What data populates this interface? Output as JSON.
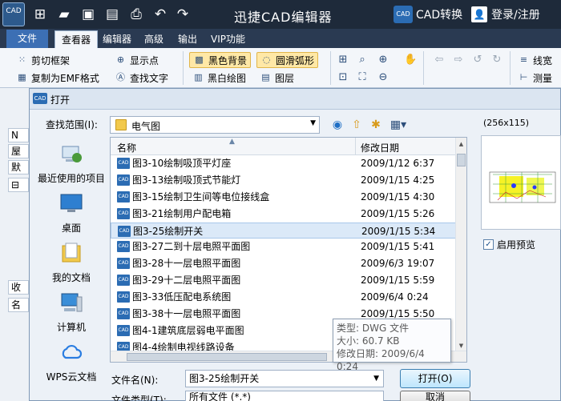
{
  "app": {
    "logo_text": "CAD",
    "title": "迅捷CAD编辑器",
    "convert_label": "CAD转换",
    "convert_icon_text": "CAD",
    "login_label": "登录/注册"
  },
  "ribbon": {
    "tabs": [
      "文件",
      "查看器",
      "编辑器",
      "高级",
      "输出",
      "VIP功能"
    ],
    "active_tab": "查看器",
    "buttons": {
      "clip_frame": "剪切框架",
      "copy_emf": "复制为EMF格式",
      "show_point": "显示点",
      "find_text": "查找文字",
      "black_bg": "黑色背景",
      "bw_draw": "黑白绘图",
      "smooth_arc": "圆滑弧形",
      "layers": "图层",
      "linewidth": "线宽",
      "measure": "测量"
    }
  },
  "background_left": {
    "cells": [
      "N",
      "屋",
      "默",
      "⊟",
      "收",
      "名"
    ]
  },
  "dialog": {
    "title": "打开",
    "icon_text": "CAD",
    "look_in_label": "查找范围(I):",
    "look_in_value": "电气图",
    "places": [
      {
        "label": "最近使用的项目",
        "icon": "recent-icon"
      },
      {
        "label": "桌面",
        "icon": "desktop-icon"
      },
      {
        "label": "我的文档",
        "icon": "documents-icon"
      },
      {
        "label": "计算机",
        "icon": "computer-icon"
      },
      {
        "label": "WPS云文档",
        "icon": "cloud-icon"
      }
    ],
    "columns": {
      "name": "名称",
      "date": "修改日期"
    },
    "file_icon_text": "CAD",
    "files": [
      {
        "name": "图3-10绘制吸顶平灯座",
        "date": "2009/1/12 6:37"
      },
      {
        "name": "图3-13绘制吸顶式节能灯",
        "date": "2009/1/15 4:25"
      },
      {
        "name": "图3-15绘制卫生间等电位接线盒",
        "date": "2009/1/15 4:30"
      },
      {
        "name": "图3-21绘制用户配电箱",
        "date": "2009/1/15 5:26"
      },
      {
        "name": "图3-25绘制开关",
        "date": "2009/1/15 5:34"
      },
      {
        "name": "图3-27二到十层电照平面图",
        "date": "2009/1/15 5:41"
      },
      {
        "name": "图3-28十一层电照平面图",
        "date": "2009/6/3 19:07"
      },
      {
        "name": "图3-29十二层电照平面图",
        "date": "2009/1/15 5:59"
      },
      {
        "name": "图3-33低压配电系统图",
        "date": "2009/6/4 0:24"
      },
      {
        "name": "图3-38十一层电照平面图",
        "date": "2009/1/15 5:50"
      },
      {
        "name": "图4-1建筑底层弱电平面图",
        "date": ""
      },
      {
        "name": "图4-4绘制电视线路设备",
        "date": ""
      }
    ],
    "selected_index": 4,
    "hovered_index": 8,
    "tooltip": {
      "type": "类型: DWG 文件",
      "size": "大小: 60.7 KB",
      "modified": "修改日期: 2009/6/4 0:24"
    },
    "preview_size": "(256x115)",
    "preview_enabled_label": "启用预览",
    "preview_enabled": true,
    "filename_label": "文件名(N):",
    "filename_value": "图3-25绘制开关",
    "filetype_label": "文件类型(T):",
    "filetype_value": "所有文件 (*.*)",
    "open_button": "打开(O)",
    "cancel_button": "取消"
  },
  "colors": {
    "titlebar": "#1e2a3a",
    "accent": "#3c6fb4",
    "selection": "#dbe9f8",
    "highlight": "#ffe8a6"
  }
}
